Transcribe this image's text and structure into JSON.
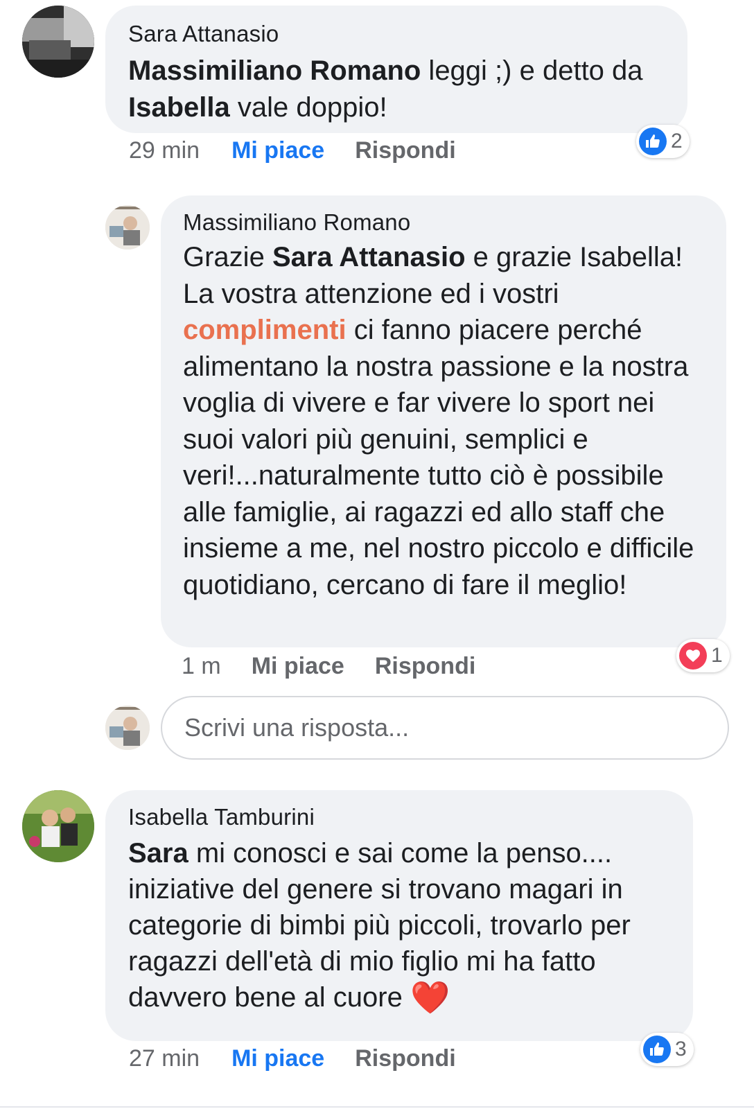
{
  "comments": [
    {
      "author": "Sara Attanasio",
      "text_parts": [
        {
          "t": "Massimiliano Romano",
          "bold": true
        },
        {
          "t": " leggi ;) e detto da "
        },
        {
          "t": "Isabella",
          "bold": true
        },
        {
          "t": " vale doppio!"
        }
      ],
      "time": "29 min",
      "like_label": "Mi piace",
      "reply_label": "Rispondi",
      "reaction": {
        "type": "like",
        "count": "2"
      }
    },
    {
      "author": "Massimiliano Romano",
      "text_parts": [
        {
          "t": "Grazie "
        },
        {
          "t": "Sara Attanasio",
          "bold": true
        },
        {
          "t": " e grazie Isabella! La vostra attenzione ed i vostri "
        },
        {
          "t": "complimenti",
          "highlight": true
        },
        {
          "t": " ci fanno piacere perché alimentano la nostra passione e la nostra voglia di vivere e far vivere lo sport nei suoi valori più genuini, semplici e veri!...naturalmente tutto ciò è possibile alle famiglie, ai ragazzi ed allo staff che insieme a me, nel nostro piccolo e difficile quotidiano, cercano di fare il meglio!"
        }
      ],
      "time": "1 m",
      "like_label": "Mi piace",
      "reply_label": "Rispondi",
      "reaction": {
        "type": "love",
        "count": "1"
      }
    },
    {
      "author": "Isabella Tamburini",
      "text_parts": [
        {
          "t": "Sara",
          "bold": true
        },
        {
          "t": " mi conosci e sai come la penso.... iniziative del genere si trovano magari in categorie di bimbi più piccoli, trovarlo per ragazzi dell'età di mio figlio mi ha fatto davvero bene al cuore "
        },
        {
          "t": "❤️",
          "emoji": true
        }
      ],
      "time": "27 min",
      "like_label": "Mi piace",
      "reply_label": "Rispondi",
      "reaction": {
        "type": "like",
        "count": "3"
      }
    }
  ],
  "reply_input": {
    "placeholder": "Scrivi una risposta..."
  },
  "colors": {
    "like_blue": "#1877f2",
    "love_red": "#f33e58",
    "highlight": "#e9714f",
    "bubble": "#f0f2f5"
  }
}
